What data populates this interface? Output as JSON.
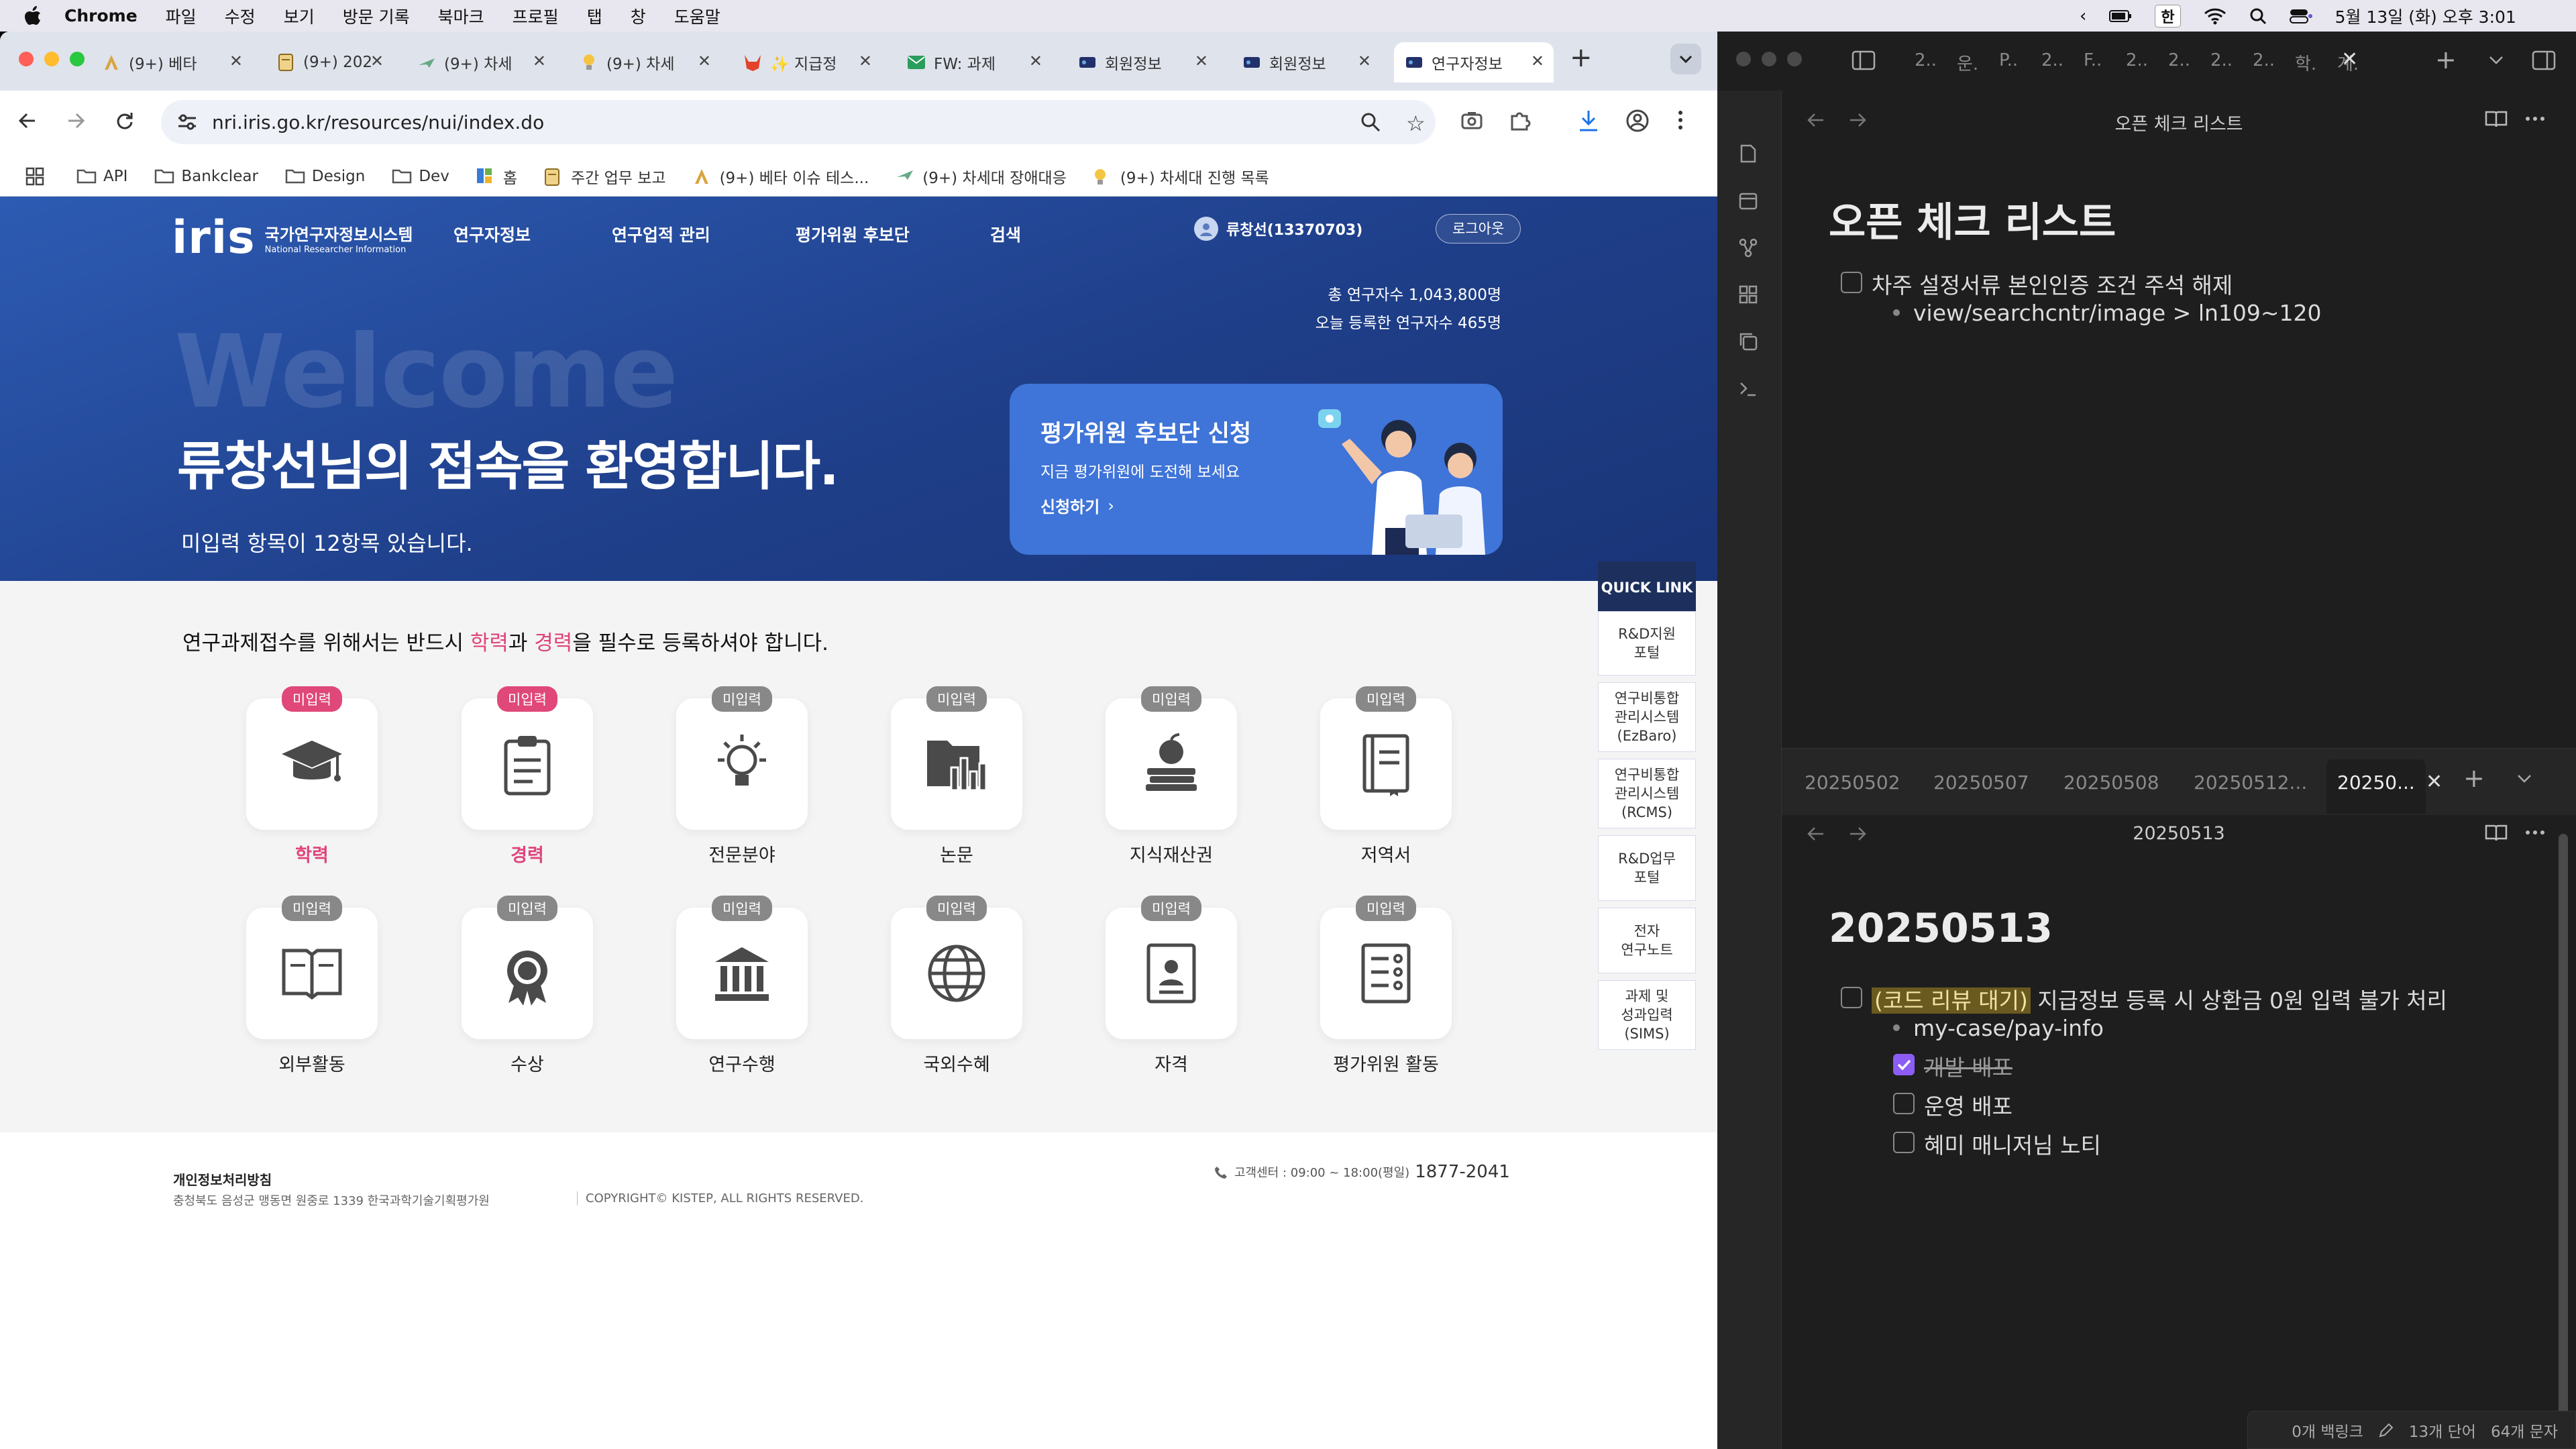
{
  "menubar": {
    "app": "Chrome",
    "items": [
      "파일",
      "수정",
      "보기",
      "방문 기록",
      "북마크",
      "프로필",
      "탭",
      "창",
      "도움말"
    ],
    "ime": "한",
    "clock": "5월 13일 (화) 오후 3:01"
  },
  "browser": {
    "tabs": [
      {
        "label": "(9+) 베타",
        "icon": "a"
      },
      {
        "label": "(9+) 202",
        "icon": "doc"
      },
      {
        "label": "(9+) 차세",
        "icon": "plane"
      },
      {
        "label": "(9+) 차세",
        "icon": "bulb"
      },
      {
        "label": "✨ 지급정",
        "icon": "fox"
      },
      {
        "label": "FW: 과제",
        "icon": "mail"
      },
      {
        "label": "회원정보",
        "icon": "iris"
      },
      {
        "label": "회원정보",
        "icon": "iris"
      },
      {
        "label": "연구자정보",
        "icon": "iris",
        "active": true
      }
    ],
    "url": "nri.iris.go.kr/resources/nui/index.do",
    "bookmarks": [
      "API",
      "Bankclear",
      "Design",
      "Dev",
      "홈",
      "주간 업무 보고",
      "(9+) 베타 이슈 테스...",
      "(9+) 차세대 장애대응",
      "(9+) 차세대 진행 목록"
    ]
  },
  "site": {
    "logo": "iris",
    "logo_kr": "국가연구자정보시스템",
    "logo_en": "National Researcher Information",
    "nav": [
      "연구자정보",
      "연구업적 관리",
      "평가위원 후보단",
      "검색"
    ],
    "user": "류창선(13370703)",
    "logout": "로그아웃",
    "stats_total": "총 연구자수 1,043,800명",
    "stats_today": "오늘 등록한 연구자수 465명",
    "welcome_bg": "Welcome",
    "hero_title": "류창선님의 접속을 환영합니다.",
    "hero_sub": "미입력 항목이 12항목 있습니다.",
    "eval_card": {
      "title": "평가위원 후보단 신청",
      "sub": "지금 평가위원에 도전해 보세요",
      "link": "신청하기"
    },
    "notice_pre": "연구과제접수를 위해서는 반드시 ",
    "notice_a": "학력",
    "notice_mid": "과 ",
    "notice_b": "경력",
    "notice_post": "을 필수로 등록하셔야 합니다.",
    "items": [
      {
        "label": "학력",
        "badge": "미입력",
        "required": true,
        "icon": "graduation-cap"
      },
      {
        "label": "경력",
        "badge": "미입력",
        "required": true,
        "icon": "clipboard"
      },
      {
        "label": "전문분야",
        "badge": "미입력",
        "required": false,
        "icon": "lightbulb"
      },
      {
        "label": "논문",
        "badge": "미입력",
        "required": false,
        "icon": "folder-chart"
      },
      {
        "label": "지식재산권",
        "badge": "미입력",
        "required": false,
        "icon": "apple-books"
      },
      {
        "label": "저역서",
        "badge": "미입력",
        "required": false,
        "icon": "book"
      },
      {
        "label": "외부활동",
        "badge": "미입력",
        "required": false,
        "icon": "open-book"
      },
      {
        "label": "수상",
        "badge": "미입력",
        "required": false,
        "icon": "award"
      },
      {
        "label": "연구수행",
        "badge": "미입력",
        "required": false,
        "icon": "institution"
      },
      {
        "label": "국외수혜",
        "badge": "미입력",
        "required": false,
        "icon": "globe"
      },
      {
        "label": "자격",
        "badge": "미입력",
        "required": false,
        "icon": "id-card"
      },
      {
        "label": "평가위원 활동",
        "badge": "미입력",
        "required": false,
        "icon": "document-list"
      }
    ],
    "quick_title": "QUICK LINK",
    "quick_links": [
      "R&D지원\n포털",
      "연구비통합\n관리시스템\n(EzBaro)",
      "연구비통합\n관리시스템\n(RCMS)",
      "R&D업무\n포털",
      "전자\n연구노트",
      "과제 및\n성과입력\n(SIMS)"
    ],
    "footer": {
      "privacy": "개인정보처리방침",
      "address": "충청북도 음성군 맹동면 원중로 1339 한국과학기술기획평가원",
      "copyright": "COPYRIGHT© KISTEP, ALL RIGHTS RESERVED.",
      "hours": "고객센터 : 09:00 ~ 18:00(평일)",
      "phone": "1877-2041"
    }
  },
  "obsidian": {
    "top_tabs": [
      "2..",
      "운.",
      "P..",
      "2..",
      "F..",
      "2..",
      "2..",
      "2..",
      "2..",
      "학.",
      "계."
    ],
    "top_title": "오픈 체크 리스트",
    "top_heading": "오픈 체크 리스트",
    "top_task": "차주 설정서류 본인인증 조건 주석 해제",
    "top_sub": "view/searchcntr/image > ln109~120",
    "bottom_tabs": [
      "20250502",
      "20250507",
      "20250508",
      "20250512...",
      "20250..."
    ],
    "bottom_title": "20250513",
    "bottom_heading": "20250513",
    "bottom_task_hl": "(코드 리뷰 대기)",
    "bottom_task": " 지급정보 등록 시 상환금 0원 입력 불가 처리",
    "bottom_sub": "my-case/pay-info",
    "subtasks": [
      {
        "label": "개발 배포",
        "done": true
      },
      {
        "label": "운영 배포",
        "done": false
      },
      {
        "label": "혜미 매니저님 노티",
        "done": false
      }
    ],
    "status": {
      "backlinks": "0개 백링크",
      "words": "13개 단어",
      "chars": "64개 문자"
    }
  }
}
